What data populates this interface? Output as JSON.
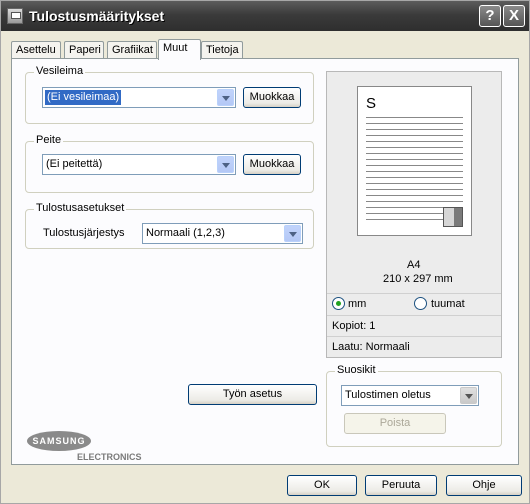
{
  "window": {
    "title": "Tulostusmääritykset",
    "help_label": "?",
    "close_label": "X"
  },
  "tabs": [
    {
      "label": "Asettelu"
    },
    {
      "label": "Paperi"
    },
    {
      "label": "Grafiikat"
    },
    {
      "label": "Muut"
    },
    {
      "label": "Tietoja"
    }
  ],
  "watermark": {
    "group_label": "Vesileima",
    "value": "(Ei vesileimaa)",
    "edit_label": "Muokkaa"
  },
  "overlay": {
    "group_label": "Peite",
    "value": "(Ei peitettä)",
    "edit_label": "Muokkaa"
  },
  "output": {
    "group_label": "Tulostusasetukset",
    "order_label": "Tulostusjärjestys",
    "order_value": "Normaali (1,2,3)"
  },
  "preview": {
    "page_letter": "S",
    "paper": "A4",
    "size": "210 x 297 mm",
    "unit_mm": "mm",
    "unit_inch": "tuumat",
    "copies": "Kopiot: 1",
    "quality": "Laatu: Normaali"
  },
  "favorites": {
    "group_label": "Suosikit",
    "value": "Tulostimen oletus",
    "delete_label": "Poista"
  },
  "job_settings_label": "Työn asetus",
  "logo": {
    "brand": "SAMSUNG",
    "sub": "ELECTRONICS"
  },
  "footer": {
    "ok": "OK",
    "cancel": "Peruuta",
    "help": "Ohje"
  },
  "colors": {
    "title_bar": "#3b3b3b",
    "selection": "#316ac5",
    "dialog_bg": "#ece9d8"
  }
}
